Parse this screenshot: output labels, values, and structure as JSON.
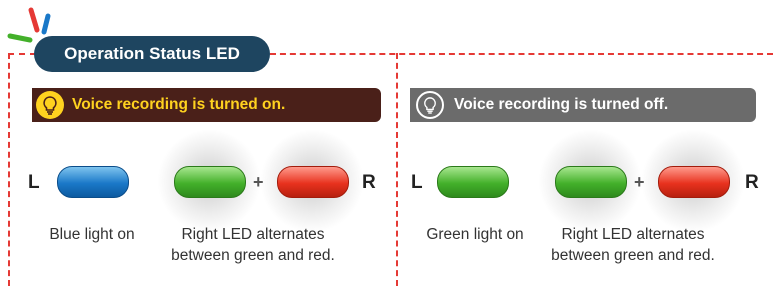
{
  "header": {
    "title": "Operation Status LED"
  },
  "panels": [
    {
      "banner": "Voice recording is turned on.",
      "left_label": "L",
      "right_label": "R",
      "plus": "+",
      "left_caption": "Blue light on",
      "right_caption_1": "Right LED alternates",
      "right_caption_2": "between green and red."
    },
    {
      "banner": "Voice recording is turned off.",
      "left_label": "L",
      "right_label": "R",
      "plus": "+",
      "left_caption": "Green light on",
      "right_caption_1": "Right LED alternates",
      "right_caption_2": "between green and red."
    }
  ],
  "colors": {
    "accent_dashed": "#e53935",
    "title_pill": "#1e4560",
    "banner_on_bg": "#4a2019",
    "banner_on_text": "#ffd21f",
    "banner_off_bg": "#6b6b6b",
    "led_blue": "#1a78c8",
    "led_green": "#43b02a",
    "led_red": "#e8321e"
  },
  "icons": [
    "sparkle-logo-icon",
    "lightbulb-icon",
    "lightbulb-icon"
  ]
}
